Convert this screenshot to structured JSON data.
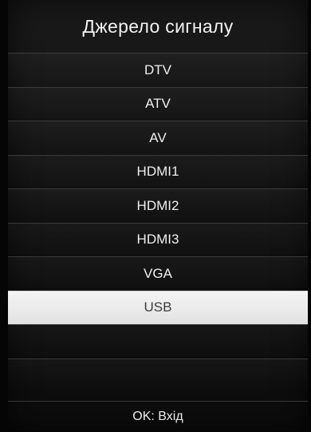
{
  "menu": {
    "title": "Джерело сигналу",
    "items": [
      {
        "label": "DTV",
        "selected": false
      },
      {
        "label": "ATV",
        "selected": false
      },
      {
        "label": "AV",
        "selected": false
      },
      {
        "label": "HDMI1",
        "selected": false
      },
      {
        "label": "HDMI2",
        "selected": false
      },
      {
        "label": "HDMI3",
        "selected": false
      },
      {
        "label": "VGA",
        "selected": false
      },
      {
        "label": "USB",
        "selected": true
      }
    ],
    "hint": "OK: Вхід"
  },
  "colors": {
    "background": "#050505",
    "highlight": "#ececec",
    "text": "#efefef",
    "selected_text": "#3b3b3b"
  }
}
